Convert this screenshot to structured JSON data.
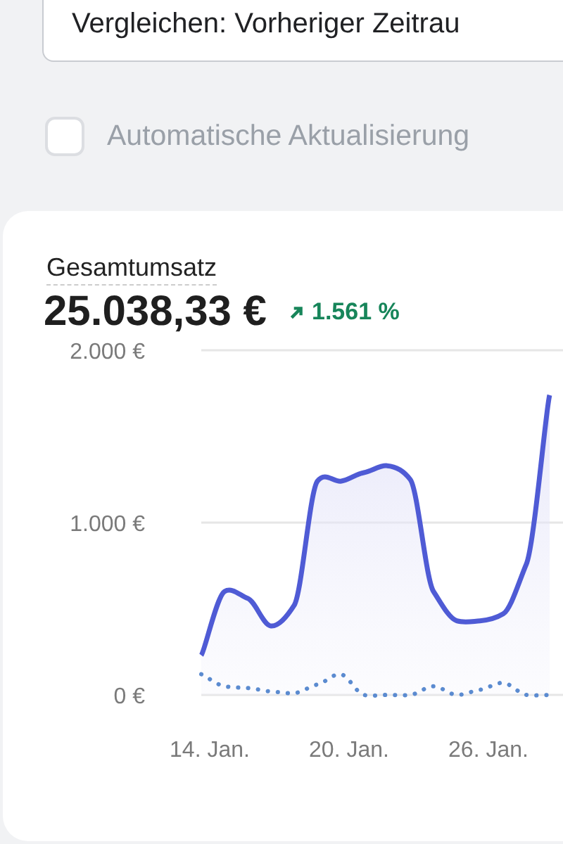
{
  "compare_dropdown": {
    "value": "Vergleichen: Vorheriger Zeitrau"
  },
  "auto_refresh": {
    "label": "Automatische Aktualisierung",
    "checked": false
  },
  "metric_card": {
    "title": "Gesamtumsatz",
    "value": "25.038,33 €",
    "change": "1.561 %",
    "chart_data": {
      "type": "area",
      "categories": [
        "14. Jan.",
        null,
        null,
        null,
        null,
        null,
        "20. Jan.",
        null,
        null,
        null,
        null,
        null,
        "26. Jan.",
        null,
        null,
        null
      ],
      "series": [
        {
          "color": "#4f5bd5",
          "values": [
            230,
            600,
            560,
            400,
            520,
            1240,
            1240,
            1290,
            1330,
            1250,
            600,
            430,
            430,
            470,
            760,
            1740
          ]
        },
        {
          "type": "line",
          "line_style": "dotted",
          "color": "#5b8bd0",
          "values": [
            120,
            50,
            40,
            20,
            10,
            60,
            120,
            0,
            0,
            0,
            50,
            0,
            30,
            70,
            0,
            0
          ]
        }
      ],
      "ylim": [
        0,
        2000
      ],
      "yticks": [
        {
          "value": 0,
          "label": "0 €"
        },
        {
          "value": 1000,
          "label": "1.000 €"
        },
        {
          "value": 2000,
          "label": "2.000 €"
        }
      ]
    }
  }
}
